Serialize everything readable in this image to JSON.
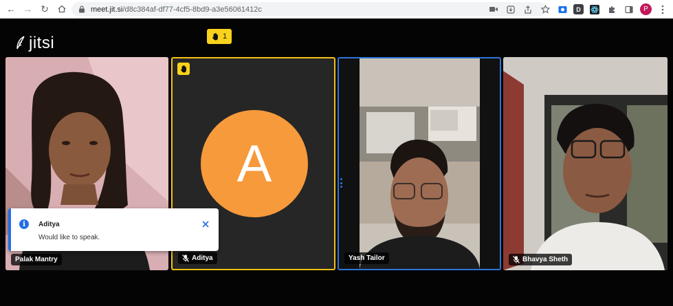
{
  "browser": {
    "url_host": "meet.jit.si",
    "url_path": "/d8c384af-df77-4cf5-8bd9-a3e56061412c",
    "profile_initial": "P",
    "ext_d_label": "D"
  },
  "meeting": {
    "logo_text": "jitsi",
    "raised_hands_count": "1",
    "participants": [
      {
        "name": "Palak Mantry",
        "muted": false,
        "video": true
      },
      {
        "name": "Aditya",
        "muted": true,
        "video": false,
        "avatar_initial": "A",
        "hand_raised": true
      },
      {
        "name": "Yash Tailor",
        "muted": false,
        "video": true
      },
      {
        "name": "Bhavya Sheth",
        "muted": true,
        "video": true
      }
    ],
    "notification": {
      "title": "Aditya",
      "message": "Would like to speak."
    }
  },
  "colors": {
    "accent_blue": "#246fe5",
    "hand_yellow": "#f8d21b",
    "avatar_orange": "#f69a3b",
    "dominant_speaker_border": "#2d75d8",
    "raised_hand_border": "#f8c215"
  }
}
